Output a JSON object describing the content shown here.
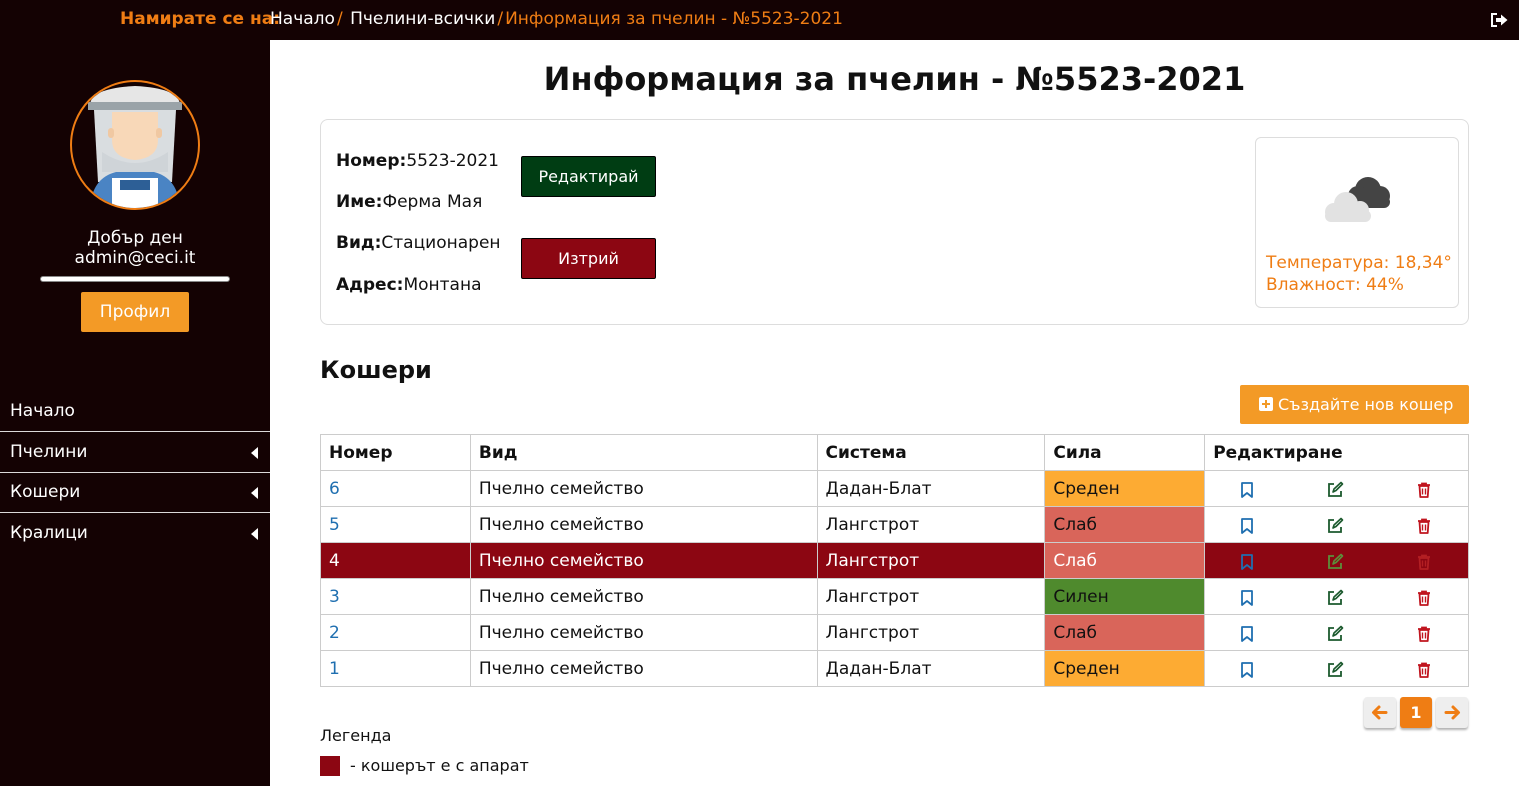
{
  "breadcrumb": {
    "here_label": "Намирате се на:",
    "items": [
      "Начало",
      "Пчелини-всички",
      "Информация за пчелин - №5523-2021"
    ],
    "separator": "/"
  },
  "sidebar": {
    "greeting": "Добър ден",
    "user": "admin@ceci.it",
    "profile_button": "Профил",
    "nav": [
      "Начало",
      "Пчелини",
      "Кошери",
      "Кралици"
    ]
  },
  "page": {
    "title": "Информация за пчелин - №5523-2021"
  },
  "apiary": {
    "number_label": "Номер:",
    "number": "5523-2021",
    "name_label": "Име:",
    "name": "Ферма Мая",
    "type_label": "Вид:",
    "type": "Стационарен",
    "address_label": "Адрес:",
    "address": "Монтана",
    "edit_button": "Редактирай",
    "delete_button": "Изтрий"
  },
  "weather": {
    "icon": "cloud-icon",
    "temperature": "Температура: 18,34°",
    "humidity": "Влажност: 44%"
  },
  "hives": {
    "title": "Кошери",
    "create_button": "Създайте нов кошер",
    "columns": [
      "Номер",
      "Вид",
      "Система",
      "Сила",
      "Редактиране"
    ],
    "rows": [
      {
        "number": "6",
        "type": "Пчелно семейство",
        "system": "Дадан-Блат",
        "strength": "Среден",
        "strength_color": "#fdab33",
        "device": false
      },
      {
        "number": "5",
        "type": "Пчелно семейство",
        "system": "Лангстрот",
        "strength": "Слаб",
        "strength_color": "#d9655a",
        "device": false
      },
      {
        "number": "4",
        "type": "Пчелно семейство",
        "system": "Лангстрот",
        "strength": "Слаб",
        "strength_color": "#d9655a",
        "device": true
      },
      {
        "number": "3",
        "type": "Пчелно семейство",
        "system": "Лангстрот",
        "strength": "Силен",
        "strength_color": "#4f8a2d",
        "device": false
      },
      {
        "number": "2",
        "type": "Пчелно семейство",
        "system": "Лангстрот",
        "strength": "Слаб",
        "strength_color": "#d9655a",
        "device": false
      },
      {
        "number": "1",
        "type": "Пчелно семейство",
        "system": "Дадан-Блат",
        "strength": "Среден",
        "strength_color": "#fdab33",
        "device": false
      }
    ]
  },
  "pagination": {
    "current_page": "1"
  },
  "legend": {
    "title": "Легенда",
    "device_text": "- кошерът е с апарат",
    "device_color": "#8c0612"
  },
  "colors": {
    "accent": "#ef7d14",
    "sidebar_bg": "#140203",
    "edit_green": "#003d13",
    "delete_red": "#8c0612"
  }
}
